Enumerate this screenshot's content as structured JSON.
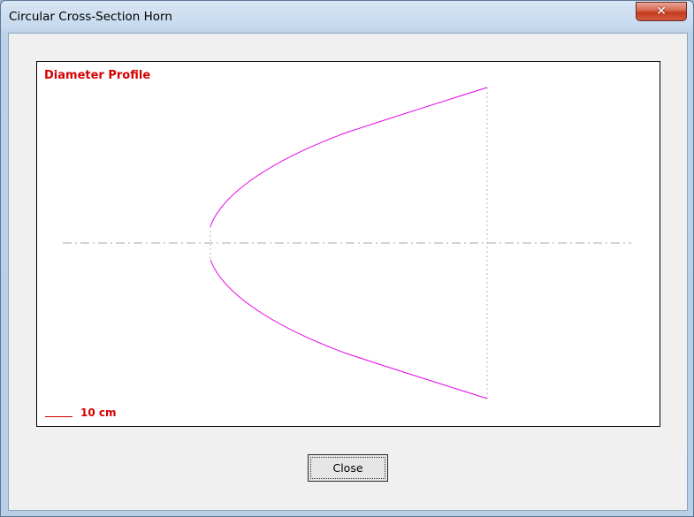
{
  "window": {
    "title": "Circular Cross-Section Horn",
    "close_glyph": "✕"
  },
  "plot": {
    "title": "Diameter Profile",
    "scale_label": "10 cm",
    "profile_color": "#e600e6",
    "title_color": "#d40000"
  },
  "buttons": {
    "close_label": "Close"
  }
}
